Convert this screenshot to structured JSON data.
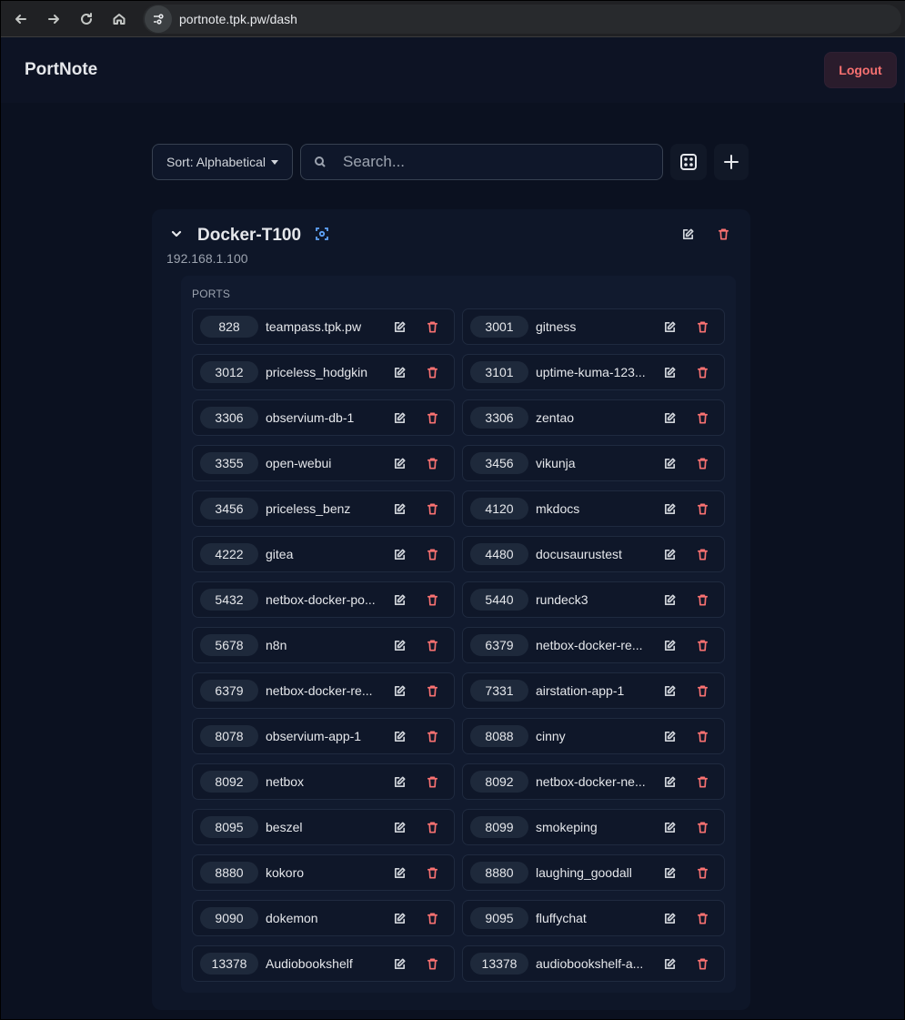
{
  "browser": {
    "url": "portnote.tpk.pw/dash"
  },
  "app": {
    "title": "PortNote",
    "logout_label": "Logout"
  },
  "toolbar": {
    "sort_label": "Sort: Alphabetical",
    "search_placeholder": "Search..."
  },
  "server": {
    "name": "Docker-T100",
    "ip": "192.168.1.100",
    "ports_heading": "PORTS",
    "ports": [
      {
        "port": "828",
        "name": "teampass.tpk.pw"
      },
      {
        "port": "3001",
        "name": "gitness"
      },
      {
        "port": "3012",
        "name": "priceless_hodgkin"
      },
      {
        "port": "3101",
        "name": "uptime-kuma-123..."
      },
      {
        "port": "3306",
        "name": "observium-db-1"
      },
      {
        "port": "3306",
        "name": "zentao"
      },
      {
        "port": "3355",
        "name": "open-webui"
      },
      {
        "port": "3456",
        "name": "vikunja"
      },
      {
        "port": "3456",
        "name": "priceless_benz"
      },
      {
        "port": "4120",
        "name": "mkdocs"
      },
      {
        "port": "4222",
        "name": "gitea"
      },
      {
        "port": "4480",
        "name": "docusaurustest"
      },
      {
        "port": "5432",
        "name": "netbox-docker-po..."
      },
      {
        "port": "5440",
        "name": "rundeck3"
      },
      {
        "port": "5678",
        "name": "n8n"
      },
      {
        "port": "6379",
        "name": "netbox-docker-re..."
      },
      {
        "port": "6379",
        "name": "netbox-docker-re..."
      },
      {
        "port": "7331",
        "name": "airstation-app-1"
      },
      {
        "port": "8078",
        "name": "observium-app-1"
      },
      {
        "port": "8088",
        "name": "cinny"
      },
      {
        "port": "8092",
        "name": "netbox"
      },
      {
        "port": "8092",
        "name": "netbox-docker-ne..."
      },
      {
        "port": "8095",
        "name": "beszel"
      },
      {
        "port": "8099",
        "name": "smokeping"
      },
      {
        "port": "8880",
        "name": "kokoro"
      },
      {
        "port": "8880",
        "name": "laughing_goodall"
      },
      {
        "port": "9090",
        "name": "dokemon"
      },
      {
        "port": "9095",
        "name": "fluffychat"
      },
      {
        "port": "13378",
        "name": "Audiobookshelf"
      },
      {
        "port": "13378",
        "name": "audiobookshelf-a..."
      }
    ]
  },
  "icons": [
    "back-icon",
    "forward-icon",
    "reload-icon",
    "home-icon",
    "site-info-icon",
    "search-icon",
    "dice-icon",
    "plus-icon",
    "chevron-down-icon",
    "scan-icon",
    "edit-icon",
    "trash-icon"
  ]
}
